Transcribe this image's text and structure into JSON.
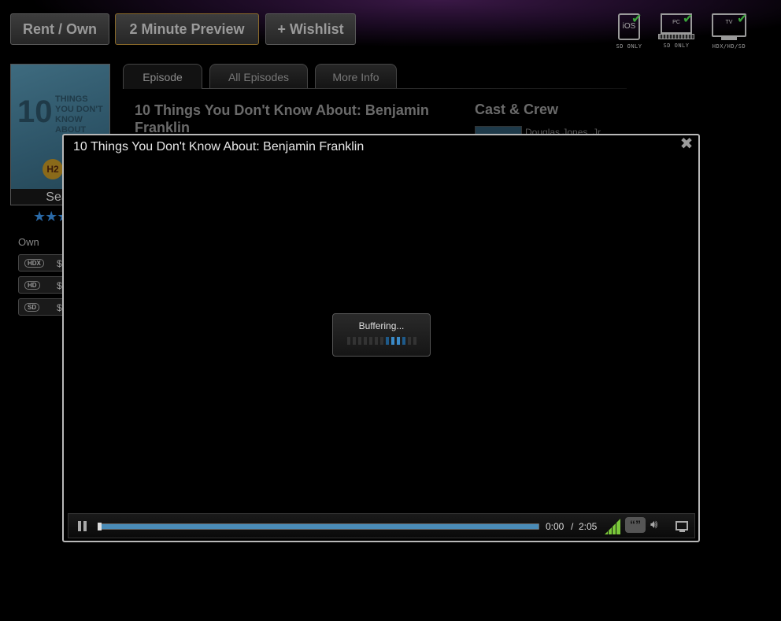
{
  "header": {
    "rent_own_label": "Rent / Own",
    "preview_label": "2 Minute Preview",
    "wishlist_label": "+ Wishlist"
  },
  "devices": [
    {
      "name": "iOS",
      "label": "SD ONLY"
    },
    {
      "name": "PC",
      "label": "SD ONLY"
    },
    {
      "name": "TV",
      "label": "HDX/HD/SD"
    }
  ],
  "poster": {
    "number": "10",
    "title_words": [
      "THINGS",
      "YOU DON'T",
      "KNOW ABOUT"
    ],
    "season_label": "Seas"
  },
  "rating": {
    "stars_visible": "★★★"
  },
  "own": {
    "label": "Own",
    "formats": [
      {
        "format": "HDX",
        "price": "$"
      },
      {
        "format": "HD",
        "price": "$"
      },
      {
        "format": "SD",
        "price": "$"
      }
    ]
  },
  "tabs": [
    {
      "label": "Episode"
    },
    {
      "label": "All Episodes"
    },
    {
      "label": "More Info"
    }
  ],
  "episode": {
    "title": "10 Things You Don't Know About: Benjamin Franklin"
  },
  "cast": {
    "heading": "Cast & Crew",
    "first_name": "Douglas Jones, Jr."
  },
  "player": {
    "title": "10 Things You Don't Know About: Benjamin Franklin",
    "close_icon": "✖",
    "buffering_text": "Buffering...",
    "current_time": "0:00",
    "separator": "/",
    "total_time": "2:05",
    "progress": 0.0,
    "cc_label": "“”",
    "accent_color": "#3a8ac8"
  }
}
